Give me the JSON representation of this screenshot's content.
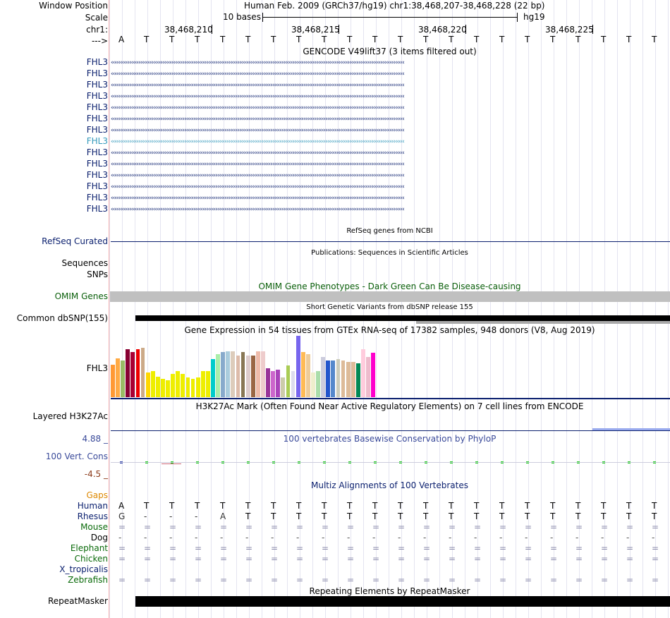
{
  "header": {
    "window_position_label": "Window Position",
    "window_position_value": "Human Feb. 2009 (GRCh37/hg19)   chr1:38,468,207-38,468,228 (22 bp)",
    "scale_label": "Scale",
    "scale_value": "10 bases",
    "scale_assembly": "hg19",
    "chr_label": "chr1:",
    "coords": [
      "38,468,210",
      "38,468,215",
      "38,468,220",
      "38,468,225"
    ],
    "strand_label": "--->",
    "bases": [
      "A",
      "T",
      "T",
      "T",
      "T",
      "T",
      "T",
      "T",
      "T",
      "T",
      "T",
      "T",
      "T",
      "T",
      "T",
      "T",
      "T",
      "T",
      "T",
      "T",
      "T",
      "T"
    ]
  },
  "gencode": {
    "title": "GENCODE V49lift37 (3 items filtered out)",
    "genes": [
      "FHL3",
      "FHL3",
      "FHL3",
      "FHL3",
      "FHL3",
      "FHL3",
      "FHL3",
      "FHL3",
      "FHL3",
      "FHL3",
      "FHL3",
      "FHL3",
      "FHL3",
      "FHL3"
    ],
    "highlight_index": 7,
    "color": "#0a1f6e",
    "highlight_color": "#3399bb"
  },
  "refseq": {
    "title": "RefSeq genes from NCBI",
    "label": "RefSeq Curated",
    "color": "#0a1f6e"
  },
  "publications": {
    "title": "Publications: Sequences in Scientific Articles",
    "label1": "Sequences",
    "label2": "SNPs"
  },
  "omim": {
    "title": "OMIM Gene Phenotypes - Dark Green Can Be Disease-causing",
    "label": "OMIM Genes",
    "color": "#0a5f0a"
  },
  "dbsnp": {
    "title": "Short Genetic Variants from dbSNP release 155",
    "label": "Common dbSNP(155)"
  },
  "gtex": {
    "title": "Gene Expression in 54 tissues from GTEx RNA-seq of 17382 samples, 948 donors (V8, Aug 2019)",
    "label": "FHL3",
    "bars": [
      {
        "c": "#ff9933",
        "v": 0.53
      },
      {
        "c": "#ffaa44",
        "v": 0.63
      },
      {
        "c": "#99bb66",
        "v": 0.6
      },
      {
        "c": "#880033",
        "v": 0.78
      },
      {
        "c": "#aa0033",
        "v": 0.74
      },
      {
        "c": "#ee0000",
        "v": 0.78
      },
      {
        "c": "#ccaa88",
        "v": 0.8
      },
      {
        "c": "#ffd700",
        "v": 0.4
      },
      {
        "c": "#eeee00",
        "v": 0.42
      },
      {
        "c": "#eeee00",
        "v": 0.33
      },
      {
        "c": "#eeee00",
        "v": 0.3
      },
      {
        "c": "#eeee00",
        "v": 0.28
      },
      {
        "c": "#eeee00",
        "v": 0.38
      },
      {
        "c": "#eeee00",
        "v": 0.42
      },
      {
        "c": "#eeee00",
        "v": 0.38
      },
      {
        "c": "#eeee00",
        "v": 0.32
      },
      {
        "c": "#eeee00",
        "v": 0.3
      },
      {
        "c": "#eeee00",
        "v": 0.32
      },
      {
        "c": "#eeee00",
        "v": 0.42
      },
      {
        "c": "#eeee00",
        "v": 0.42
      },
      {
        "c": "#00cccc",
        "v": 0.62
      },
      {
        "c": "#aaeeaa",
        "v": 0.7
      },
      {
        "c": "#88aacc",
        "v": 0.73
      },
      {
        "c": "#aaccdd",
        "v": 0.75
      },
      {
        "c": "#ddccbb",
        "v": 0.75
      },
      {
        "c": "#ddbbaa",
        "v": 0.68
      },
      {
        "c": "#887755",
        "v": 0.73
      },
      {
        "c": "#ddcccc",
        "v": 0.68
      },
      {
        "c": "#996644",
        "v": 0.68
      },
      {
        "c": "#eebbaa",
        "v": 0.75
      },
      {
        "c": "#eecccc",
        "v": 0.75
      },
      {
        "c": "#993399",
        "v": 0.47
      },
      {
        "c": "#cc66cc",
        "v": 0.43
      },
      {
        "c": "#aa44bb",
        "v": 0.45
      },
      {
        "c": "#ccccaa",
        "v": 0.32
      },
      {
        "c": "#aacc55",
        "v": 0.52
      },
      {
        "c": "#ddddee",
        "v": 0.42
      },
      {
        "c": "#7766ee",
        "v": 1.0
      },
      {
        "c": "#ffbb55",
        "v": 0.73
      },
      {
        "c": "#eecc99",
        "v": 0.7
      },
      {
        "c": "#eeeecc",
        "v": 0.4
      },
      {
        "c": "#aaddaa",
        "v": 0.42
      },
      {
        "c": "#ccccdd",
        "v": 0.65
      },
      {
        "c": "#2255cc",
        "v": 0.6
      },
      {
        "c": "#5588cc",
        "v": 0.6
      },
      {
        "c": "#ccccbb",
        "v": 0.62
      },
      {
        "c": "#ddbb99",
        "v": 0.6
      },
      {
        "c": "#ddbb99",
        "v": 0.58
      },
      {
        "c": "#ddbb99",
        "v": 0.58
      },
      {
        "c": "#008855",
        "v": 0.55
      },
      {
        "c": "#ffccdd",
        "v": 0.78
      },
      {
        "c": "#eebbcc",
        "v": 0.65
      },
      {
        "c": "#ff00cc",
        "v": 0.72
      }
    ]
  },
  "h3k27ac": {
    "title": "H3K27Ac Mark (Often Found Near Active Regulatory Elements) on 7 cell lines from ENCODE",
    "label": "Layered H3K27Ac"
  },
  "phylop": {
    "title": "100 vertebrates Basewise Conservation by PhyloP",
    "label": "100 Vert. Cons",
    "max": "4.88 _",
    "min": "-4.5 _",
    "label_color": "#3a4a9a",
    "min_color": "#8b3a1a"
  },
  "multiz": {
    "title": "Multiz Alignments of 100 Vertebrates",
    "gaps_label": "Gaps",
    "species": [
      {
        "name": "Human",
        "color": "#0a1f6e",
        "bases": [
          "A",
          "T",
          "T",
          "T",
          "T",
          "T",
          "T",
          "T",
          "T",
          "T",
          "T",
          "T",
          "T",
          "T",
          "T",
          "T",
          "T",
          "T",
          "T",
          "T",
          "T",
          "T"
        ],
        "bcolor": "#000000"
      },
      {
        "name": "Rhesus",
        "color": "#0a1f6e",
        "bases": [
          "G",
          "-",
          "-",
          "-",
          "A",
          "T",
          "T",
          "T",
          "T",
          "T",
          "T",
          "T",
          "T",
          "T",
          "T",
          "T",
          "T",
          "T",
          "T",
          "T",
          "T",
          "T"
        ],
        "bcolor": "#333333"
      },
      {
        "name": "Mouse",
        "color": "#0a6a0a",
        "bases": [
          "=",
          "=",
          "=",
          "=",
          "=",
          "=",
          "=",
          "=",
          "=",
          "=",
          "=",
          "=",
          "=",
          "=",
          "=",
          "=",
          "=",
          "=",
          "=",
          "=",
          "=",
          "="
        ],
        "bcolor": "#8888aa"
      },
      {
        "name": "Dog",
        "color": "#000000",
        "bases": [
          "-",
          "-",
          "-",
          "-",
          "-",
          "-",
          "-",
          "-",
          "-",
          "-",
          "-",
          "-",
          "-",
          "-",
          "-",
          "-",
          "-",
          "-",
          "-",
          "-",
          "-",
          "-"
        ],
        "bcolor": "#555555"
      },
      {
        "name": "Elephant",
        "color": "#0a6a0a",
        "bases": [
          "=",
          "=",
          "=",
          "=",
          "=",
          "=",
          "=",
          "=",
          "=",
          "=",
          "=",
          "=",
          "=",
          "=",
          "=",
          "=",
          "=",
          "=",
          "=",
          "=",
          "=",
          "="
        ],
        "bcolor": "#8888aa"
      },
      {
        "name": "Chicken",
        "color": "#0a6a0a",
        "bases": [
          "=",
          "=",
          "=",
          "=",
          "=",
          "=",
          "=",
          "=",
          "=",
          "=",
          "=",
          "=",
          "=",
          "=",
          "=",
          "=",
          "=",
          "=",
          "=",
          "=",
          "=",
          "="
        ],
        "bcolor": "#8888aa"
      },
      {
        "name": "X_tropicalis",
        "color": "#0a1f6e",
        "bases": [],
        "bcolor": "#8888aa"
      },
      {
        "name": "Zebrafish",
        "color": "#0a6a0a",
        "bases": [
          "=",
          "=",
          "=",
          "=",
          "=",
          "=",
          "=",
          "=",
          "=",
          "=",
          "=",
          "=",
          "=",
          "=",
          "=",
          "=",
          "=",
          "=",
          "=",
          "=",
          "=",
          "="
        ],
        "bcolor": "#8888aa"
      }
    ],
    "gaps_color": "#dd8800"
  },
  "repeatmasker": {
    "title": "Repeating Elements by RepeatMasker",
    "label": "RepeatMasker"
  }
}
